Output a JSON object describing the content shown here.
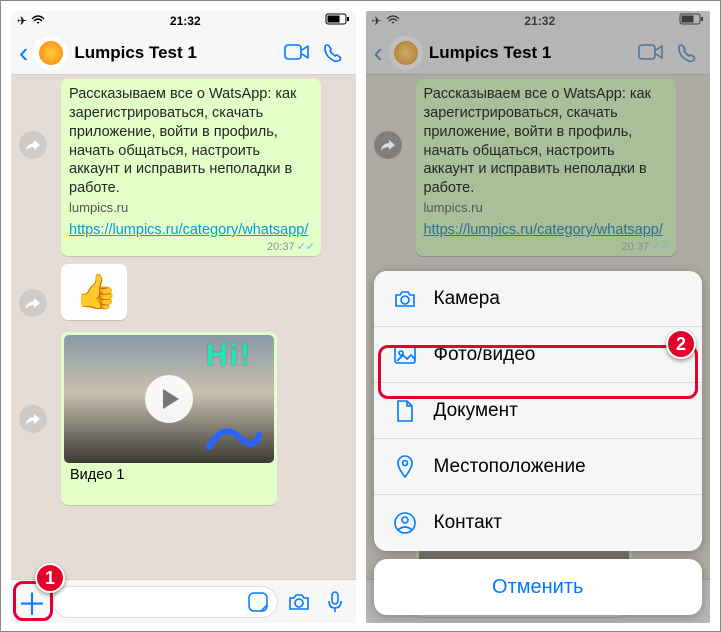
{
  "status": {
    "time": "21:32"
  },
  "header": {
    "title": "Lumpics Test 1"
  },
  "msg": {
    "text": "Рассказываем все о WatsApp: как зарегистрироваться, скачать приложение, войти в профиль, начать общаться, настроить аккаунт и исправить неполадки в работе.",
    "site": "lumpics.ru",
    "link": "https://lumpics.ru/category/whatsapp/",
    "time": "20:37",
    "ticks": "✓✓",
    "video_caption": "Видео 1",
    "hi": "Hi!"
  },
  "emoji": "👍",
  "sheet": {
    "camera": "Камера",
    "photo": "Фото/видео",
    "document": "Документ",
    "location": "Местоположение",
    "contact": "Контакт",
    "cancel": "Отменить"
  },
  "callouts": {
    "one": "1",
    "two": "2"
  }
}
